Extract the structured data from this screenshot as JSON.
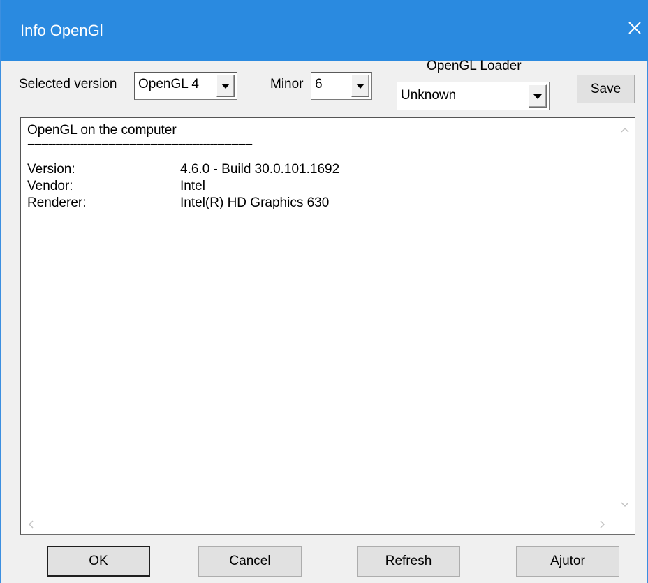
{
  "window": {
    "title": "Info OpenGl"
  },
  "toolbar": {
    "selected_version_label": "Selected version",
    "selected_version_value": "OpenGL 4",
    "minor_label": "Minor",
    "minor_value": "6",
    "loader_label": "OpenGL Loader",
    "loader_value": "Unknown",
    "save_label": "Save"
  },
  "info": {
    "heading": "OpenGL on the computer",
    "separator": "----------------------------------------------------------------",
    "rows": [
      {
        "label": "Version:",
        "value": "4.6.0 - Build 30.0.101.1692"
      },
      {
        "label": "Vendor:",
        "value": "Intel"
      },
      {
        "label": "Renderer:",
        "value": "Intel(R) HD Graphics 630"
      }
    ]
  },
  "buttons": {
    "ok": "OK",
    "cancel": "Cancel",
    "refresh": "Refresh",
    "help": "Ajutor"
  },
  "colors": {
    "titlebar": "#2a8ae0",
    "dialog_bg": "#f0f0f0",
    "button_bg": "#e1e1e1"
  },
  "icons": {
    "close": "close-icon",
    "dropdown": "chevron-down-icon",
    "scroll_up": "scroll-up-icon",
    "scroll_down": "scroll-down-icon",
    "scroll_left": "scroll-left-icon",
    "scroll_right": "scroll-right-icon"
  }
}
